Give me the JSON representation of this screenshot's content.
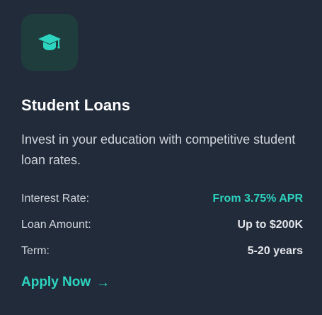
{
  "card": {
    "icon": "graduation-cap-icon",
    "title": "Student Loans",
    "description": "Invest in your education with competitive student loan rates.",
    "details": [
      {
        "label": "Interest Rate:",
        "value": "From 3.75% APR"
      },
      {
        "label": "Loan Amount:",
        "value": "Up to $200K"
      },
      {
        "label": "Term:",
        "value": "5-20 years"
      }
    ],
    "cta_label": "Apply Now",
    "cta_arrow": "→"
  },
  "colors": {
    "background": "#212b3a",
    "accent": "#2dd4bf",
    "icon_bg": "#1f3d3d",
    "title": "#ffffff",
    "text": "#d1d5db"
  }
}
